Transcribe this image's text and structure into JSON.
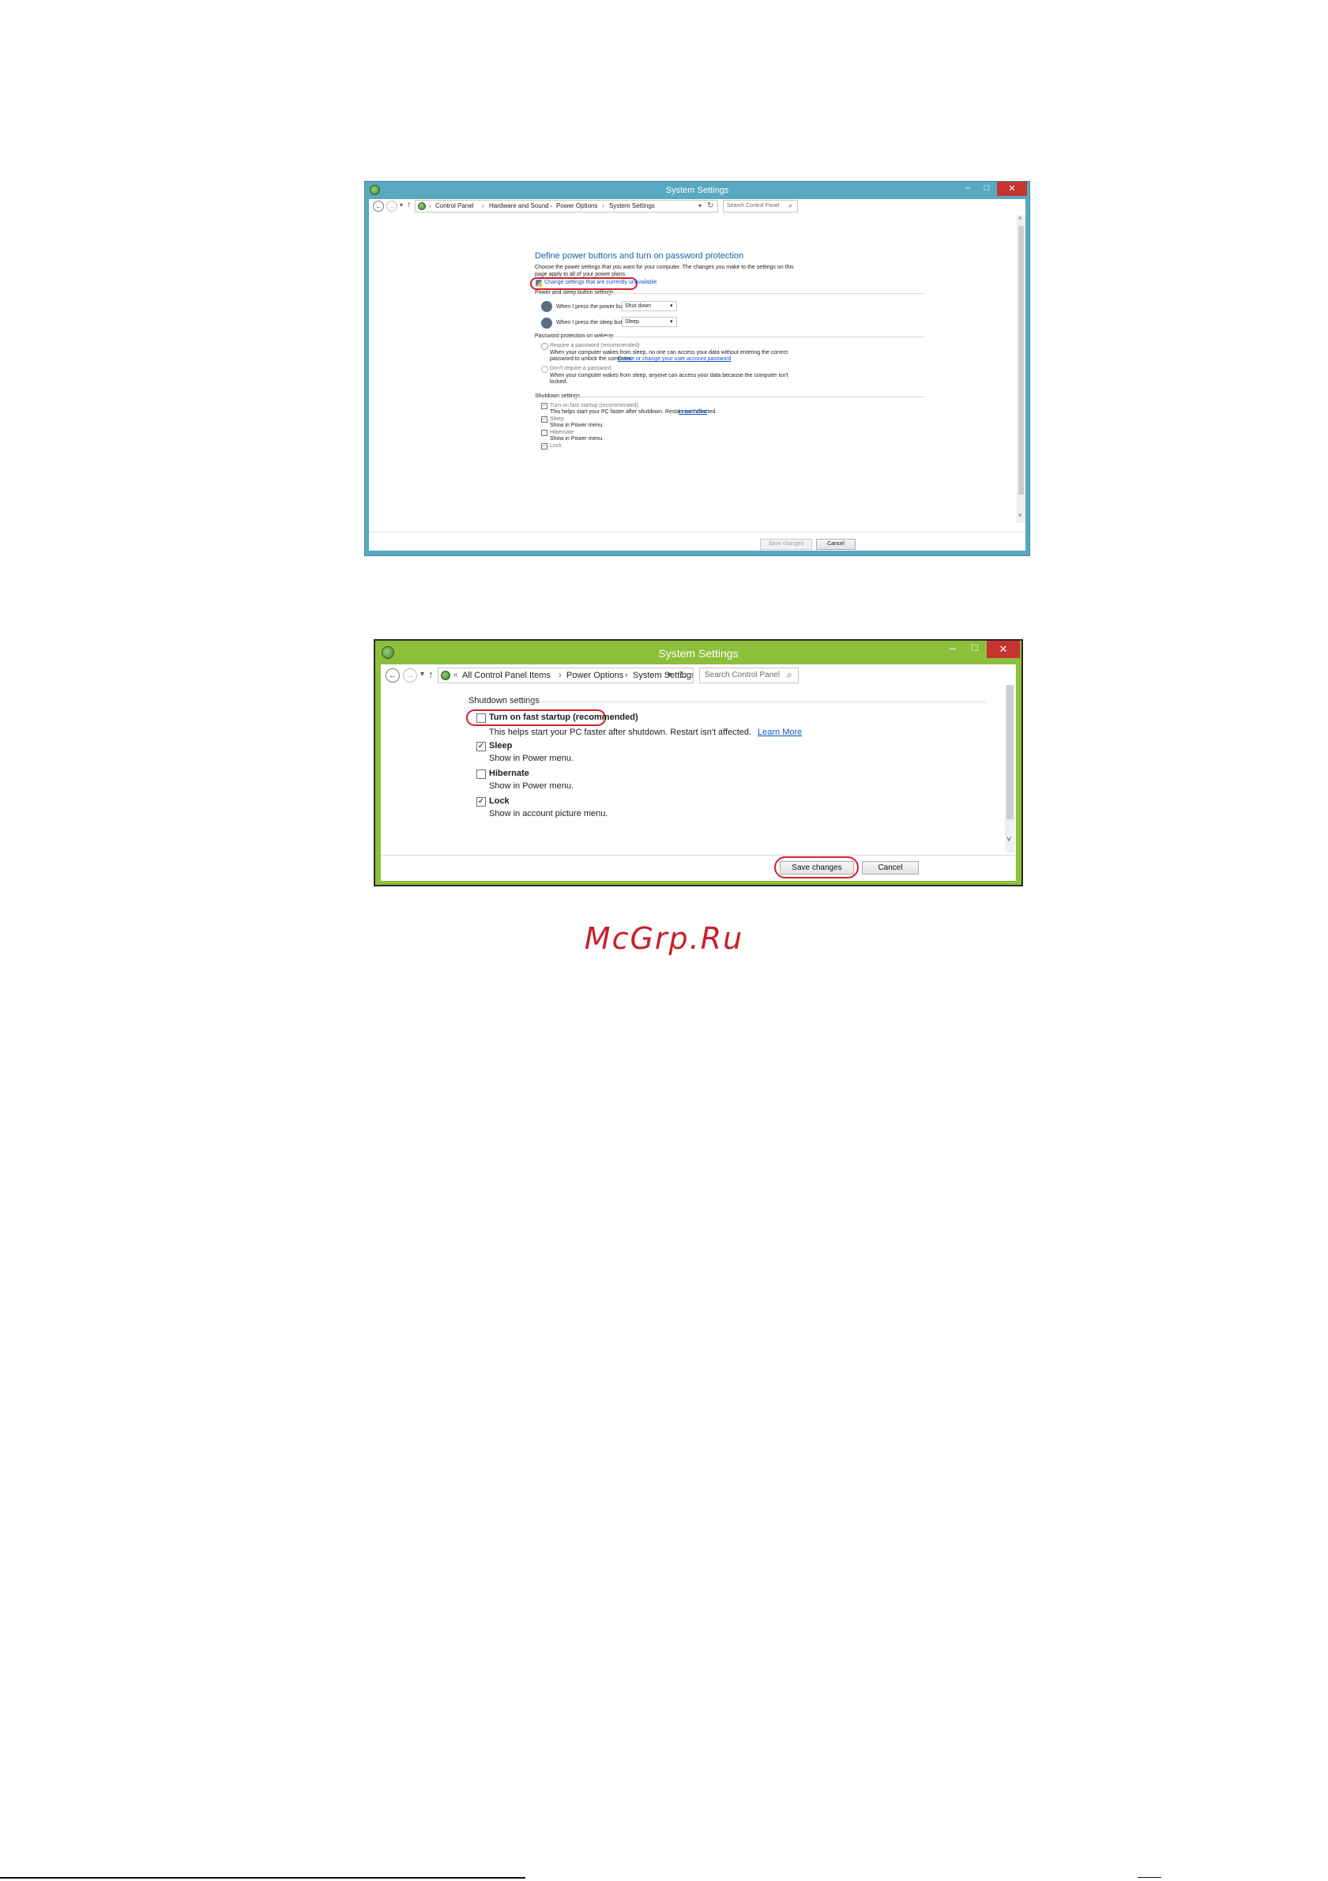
{
  "window1": {
    "title": "System Settings",
    "minimize": "–",
    "maximize": "□",
    "close": "✕",
    "back": "←",
    "forward": "→",
    "dropdown": "▾",
    "up": "↑",
    "breadcrumb": [
      "Control Panel",
      "Hardware and Sound",
      "Power Options",
      "System Settings"
    ],
    "sep": "›",
    "refresh": "↻",
    "search_placeholder": "Search Control Panel",
    "search_icon": "⌕",
    "heading": "Define power buttons and turn on password protection",
    "description_1": "Choose the power settings that you want for your computer. The changes you make to the settings on this",
    "description_2": "page apply to all of your power plans.",
    "change_settings_link": "Change settings that are currently unavailable",
    "power_sleep_section": "Power and sleep button settings",
    "power_button_label": "When I press the power button:",
    "power_button_value": "Shut down",
    "sleep_button_label": "When I press the sleep button:",
    "sleep_button_value": "Sleep",
    "password_section": "Password protection on wakeup",
    "require_password": "Require a password (recommended)",
    "require_desc_1": "When your computer wakes from sleep, no one can access your data without entering the correct",
    "require_desc_2": "password to unlock the computer.",
    "account_link": "Create or change your user account password",
    "no_password": "Don't require a password",
    "no_password_desc_1": "When your computer wakes from sleep, anyone can access your data because the computer isn't",
    "no_password_desc_2": "locked.",
    "shutdown_section": "Shutdown settings",
    "fast_startup": "Turn on fast startup (recommended)",
    "fast_startup_desc": "This helps start your PC faster after shutdown. Restart isn't affected.",
    "learn_more": "Learn More",
    "sleep": "Sleep",
    "sleep_desc": "Show in Power menu.",
    "hibernate": "Hibernate",
    "hibernate_desc": "Show in Power menu.",
    "lock": "Lock",
    "save_changes": "Save changes",
    "cancel": "Cancel",
    "scroll_up": "˄",
    "scroll_down": "˅"
  },
  "window2": {
    "title": "System Settings",
    "minimize": "–",
    "maximize": "□",
    "close": "✕",
    "back": "←",
    "forward": "→",
    "dropdown": "▾",
    "up": "↑",
    "overflow": "«",
    "breadcrumb": [
      "All Control Panel Items",
      "Power Options",
      "System Settings"
    ],
    "sep": "›",
    "refresh": "↻",
    "search_placeholder": "Search Control Panel",
    "search_icon": "⌕",
    "shutdown_section": "Shutdown settings",
    "fast_startup": "Turn on fast startup (recommended)",
    "fast_startup_desc": "This helps start your PC faster after shutdown. Restart isn't affected.",
    "learn_more": "Learn More",
    "sleep": "Sleep",
    "sleep_desc": "Show in Power menu.",
    "hibernate": "Hibernate",
    "hibernate_desc": "Show in Power menu.",
    "lock": "Lock",
    "lock_desc": "Show in account picture menu.",
    "save_changes": "Save changes",
    "cancel": "Cancel",
    "scroll_down": "˅",
    "check": "✓"
  },
  "watermark": "McGrp.Ru",
  "colors": {
    "window1_frame": "#58a9c0",
    "window2_frame": "#8cbf3a",
    "highlight_ring": "#d3202c",
    "link": "#0a55c9",
    "heading": "#1c5fa8"
  }
}
